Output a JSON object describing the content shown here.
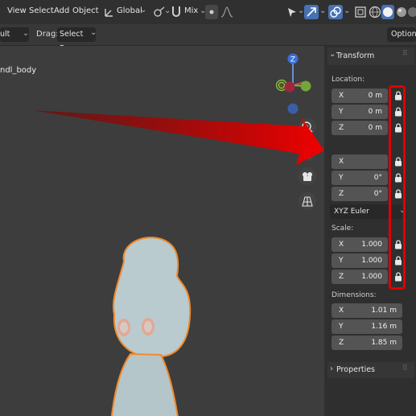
{
  "header": {
    "menu": [
      "View",
      "Select",
      "Add",
      "Object"
    ],
    "orientation": "Global",
    "shading_mode": "Mix"
  },
  "tool_header": {
    "mode_value": "ult",
    "drag_label": "Drag:",
    "drag_value": "Select Box",
    "options_label": "Options"
  },
  "viewport": {
    "object_name": "ndl_body",
    "gizmo_z": "Z"
  },
  "properties": {
    "transform_title": "Transform",
    "location_label": "Location:",
    "location": [
      {
        "axis": "X",
        "value": "0 m"
      },
      {
        "axis": "Y",
        "value": "0 m"
      },
      {
        "axis": "Z",
        "value": "0 m"
      }
    ],
    "rotation": [
      {
        "axis": "X",
        "value": ""
      },
      {
        "axis": "Y",
        "value": "0°"
      },
      {
        "axis": "Z",
        "value": "0°"
      }
    ],
    "rotation_mode": "XYZ Euler",
    "scale_label": "Scale:",
    "scale": [
      {
        "axis": "X",
        "value": "1.000"
      },
      {
        "axis": "Y",
        "value": "1.000"
      },
      {
        "axis": "Z",
        "value": "1.000"
      }
    ],
    "dimensions_label": "Dimensions:",
    "dimensions": [
      {
        "axis": "X",
        "value": "1.01 m"
      },
      {
        "axis": "Y",
        "value": "1.16 m"
      },
      {
        "axis": "Z",
        "value": "1.85 m"
      }
    ],
    "properties_title": "Properties"
  },
  "colors": {
    "highlight_red": "#e00000",
    "selection_orange": "#f08a2c",
    "panel_bg": "#2f2f2f",
    "field_bg": "#545454"
  }
}
